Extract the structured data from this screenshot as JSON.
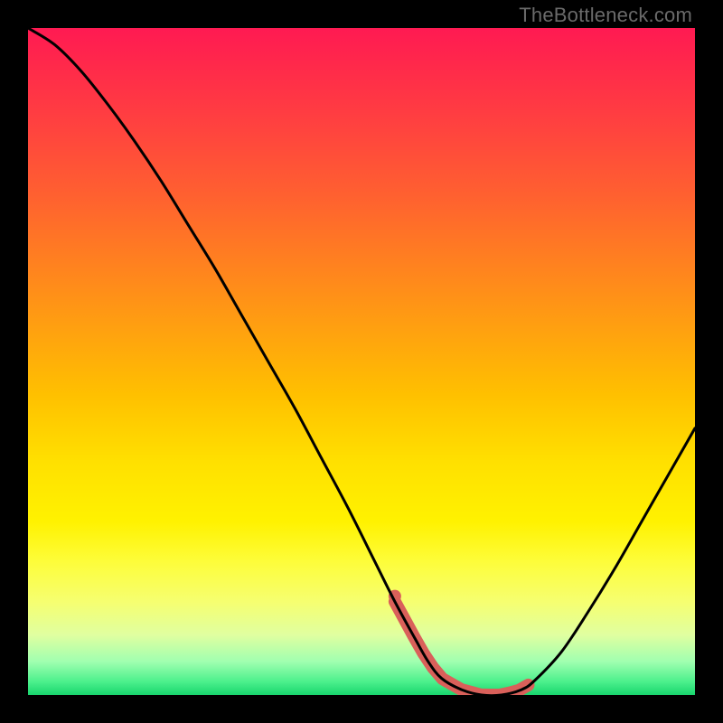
{
  "watermark": "TheBottleneck.com",
  "chart_data": {
    "type": "line",
    "title": "",
    "xlabel": "",
    "ylabel": "",
    "xlim": [
      0,
      100
    ],
    "ylim": [
      0,
      100
    ],
    "grid": false,
    "series": [
      {
        "name": "bottleneck-curve",
        "x": [
          0,
          4,
          8,
          12,
          16,
          20,
          24,
          28,
          32,
          36,
          40,
          44,
          48,
          52,
          55,
          58,
          60,
          62,
          65,
          68,
          71,
          74,
          76,
          80,
          84,
          88,
          92,
          96,
          100
        ],
        "y": [
          100,
          97.5,
          93.5,
          88.5,
          83,
          77,
          70.5,
          64,
          57,
          50,
          43,
          35.5,
          28,
          20,
          14,
          8.5,
          5,
          2.5,
          0.8,
          0,
          0,
          0.8,
          2.2,
          6.5,
          12.5,
          19,
          26,
          33,
          40
        ]
      }
    ],
    "flat_segment": {
      "x_start": 55,
      "x_end": 75,
      "color": "#d9605a"
    }
  },
  "colors": {
    "curve": "#000000",
    "flat_marker": "#d9605a",
    "frame": "#000000"
  }
}
